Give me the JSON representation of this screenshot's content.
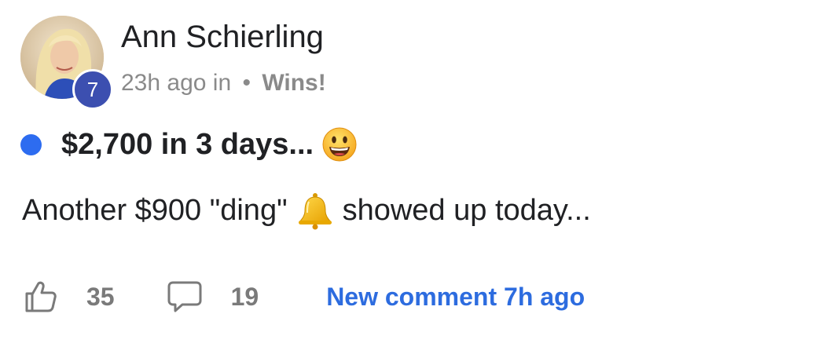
{
  "post": {
    "author": {
      "name": "Ann Schierling",
      "level": "7"
    },
    "meta": {
      "time_ago": "23h ago in",
      "separator": "•",
      "category": "Wins!"
    },
    "title": "$2,700 in 3 days...",
    "title_emoji": "grinning-face-icon",
    "body": {
      "before": "Another $900 \"ding\"",
      "emoji": "bell-icon",
      "after": "showed up today..."
    },
    "actions": {
      "likes": "35",
      "comments": "19",
      "new_comment": "New comment 7h ago"
    },
    "colors": {
      "unread_dot": "#2d6cf0",
      "level_badge": "#3c4fb0",
      "link": "#2d6cdf",
      "muted": "#8a8a8a"
    }
  }
}
